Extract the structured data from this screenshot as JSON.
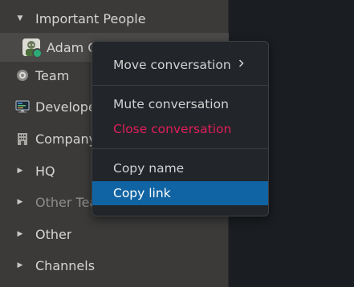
{
  "sidebar": {
    "sections": [
      {
        "label": "Important People",
        "expanded": true
      },
      {
        "label": "HQ",
        "expanded": false
      },
      {
        "label": "Other Tea",
        "expanded": false
      },
      {
        "label": "Other",
        "expanded": false
      },
      {
        "label": "Channels",
        "expanded": false
      }
    ],
    "items": {
      "adam": "Adam G",
      "team": "Team",
      "developer": "Develope",
      "company": "Company"
    }
  },
  "context_menu": {
    "move_label": "Move conversation",
    "mute_label": "Mute conversation",
    "close_label": "Close conversation",
    "copy_name_label": "Copy name",
    "copy_link_label": "Copy link"
  },
  "colors": {
    "danger": "#e01e5a",
    "highlight": "#1164a3",
    "presence": "#2bac76"
  }
}
